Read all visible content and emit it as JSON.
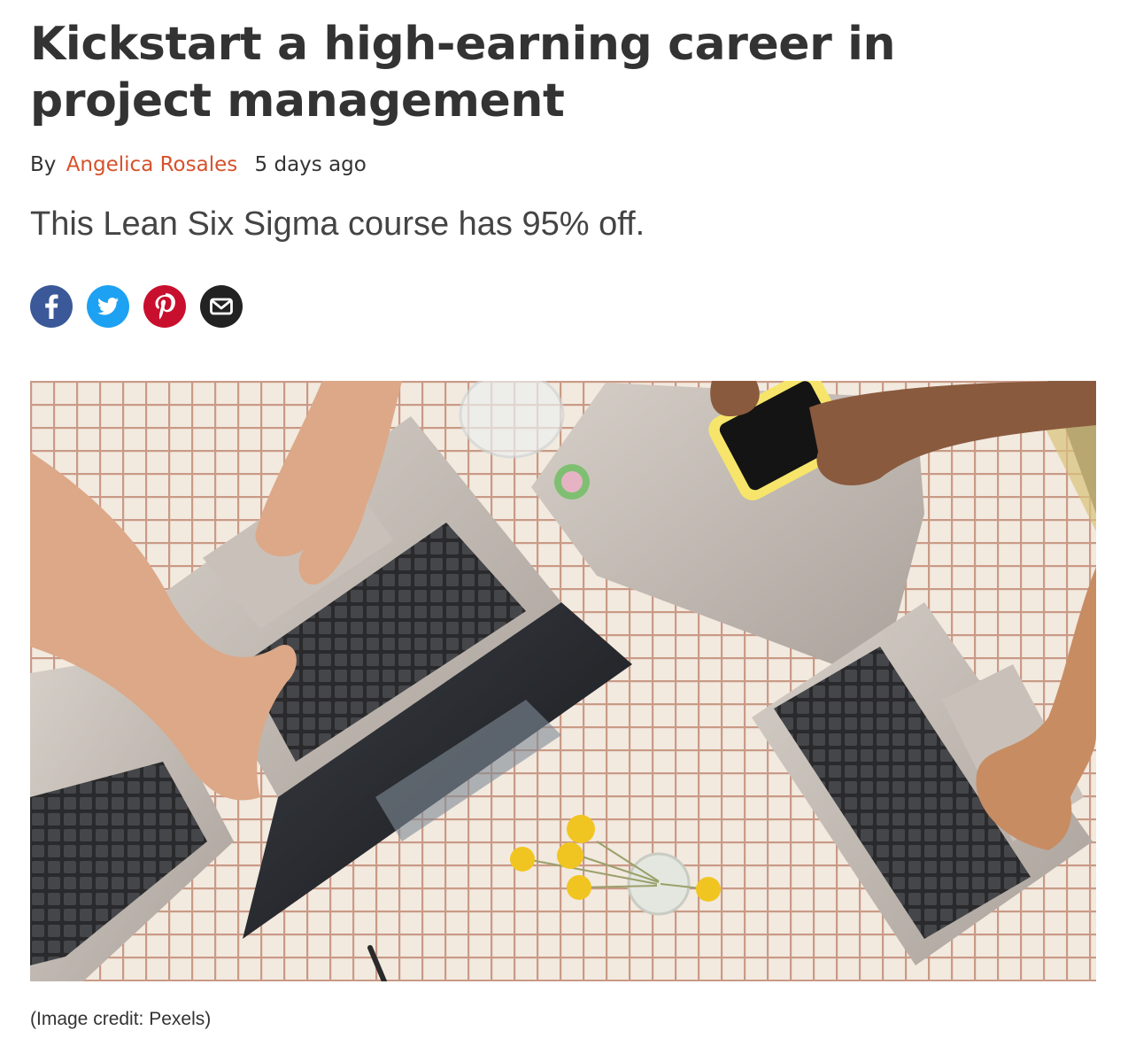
{
  "article": {
    "title": "Kickstart a high-earning career in project management",
    "byline": {
      "prefix": "By",
      "author": "Angelica Rosales",
      "date": "5 days ago"
    },
    "strapline": "This Lean Six Sigma course has 95% off.",
    "share": [
      {
        "network": "facebook",
        "icon": "facebook-icon",
        "color": "#3b5998"
      },
      {
        "network": "twitter",
        "icon": "twitter-icon",
        "color": "#1da1f2"
      },
      {
        "network": "pinterest",
        "icon": "pinterest-icon",
        "color": "#c8102e"
      },
      {
        "network": "email",
        "icon": "email-icon",
        "color": "#222222"
      }
    ],
    "hero_image": {
      "credit_open": "(",
      "credit_text": "Image credit: Pexels",
      "credit_close": ")"
    }
  },
  "colors": {
    "text": "#333333",
    "author_link": "#d5522c",
    "strapline": "#444444"
  }
}
